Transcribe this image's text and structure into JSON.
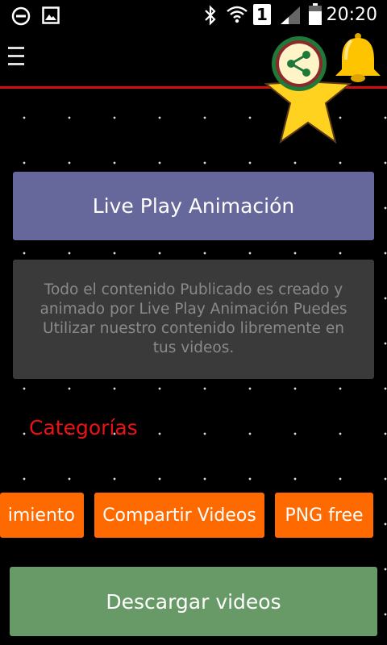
{
  "status_bar": {
    "time": "20:20",
    "sim_number": "1",
    "icons": [
      "dnd-icon",
      "image-icon",
      "bluetooth-icon",
      "wifi-icon",
      "sim-icon",
      "signal-icon",
      "battery-icon"
    ]
  },
  "app_bar": {
    "menu_icon": "hamburger-menu-icon",
    "share_icon": "share-icon",
    "bell_icon": "bell-icon",
    "accent_color": "#d01010"
  },
  "main": {
    "title": "Live Play Animación",
    "description": "Todo el contenido Publicado es creado y animado por Live Play Animación Puedes Utilizar nuestro contenido libremente en tus videos.",
    "categories_heading": "Categorías",
    "categories": [
      {
        "label": "imiento"
      },
      {
        "label": "Compartir Videos"
      },
      {
        "label": "PNG free"
      }
    ],
    "download_button": "Descargar videos"
  },
  "colors": {
    "title_card": "#66679a",
    "description_card": "#3a3a3a",
    "category_chip": "#ff6a00",
    "category_heading": "#ee1111",
    "download_button": "#679a66"
  }
}
